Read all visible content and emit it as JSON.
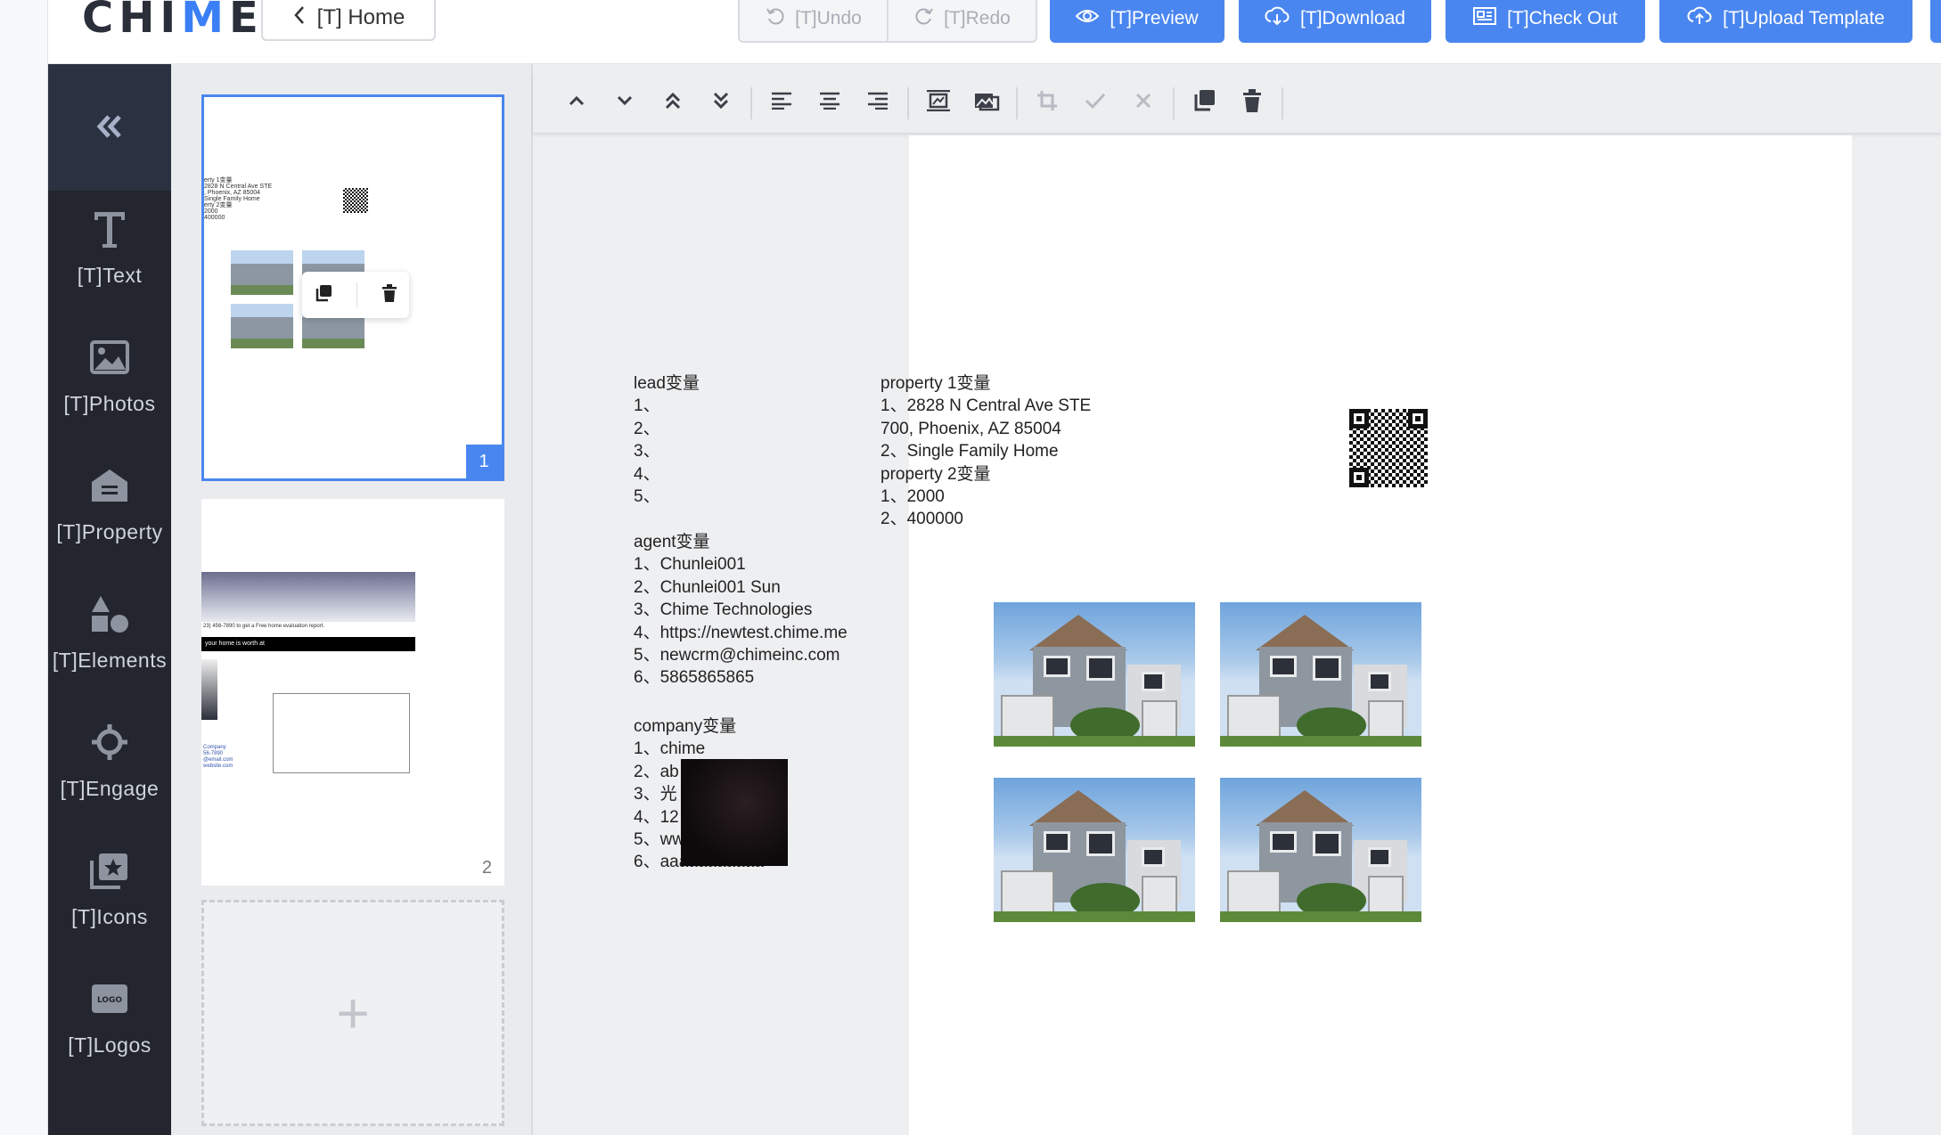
{
  "app": {
    "logo": "CHIME"
  },
  "topbar": {
    "home_label": "[T] Home",
    "undo_label": "[T]Undo",
    "redo_label": "[T]Redo",
    "preview_label": "[T]Preview",
    "download_label": "[T]Download",
    "checkout_label": "[T]Check Out",
    "upload_label": "[T]Upload Template",
    "accent_color": "#4a86f0"
  },
  "sidebar": {
    "collapse_icon": "double-chevron-left-icon",
    "items": [
      {
        "label": "[T]Text",
        "icon": "text-icon"
      },
      {
        "label": "[T]Photos",
        "icon": "image-icon"
      },
      {
        "label": "[T]Property",
        "icon": "house-icon"
      },
      {
        "label": "[T]Elements",
        "icon": "shapes-icon"
      },
      {
        "label": "[T]Engage",
        "icon": "crosshair-icon"
      },
      {
        "label": "[T]Icons",
        "icon": "star-gallery-icon"
      },
      {
        "label": "[T]Logos",
        "icon": "logo-icon"
      }
    ]
  },
  "pages": {
    "page1_number": "1",
    "page2_number": "2",
    "page1_text": "erty 1变量\n2828 N Central Ave STE\n, Phoenix, AZ 85004\nSingle Family Home\nerty 2变量\n2000\n400000",
    "page2_banner_text": "your home is worth at",
    "page2_phone_text": "23) 456-7890 to get a Free home evaluation report.",
    "page2_footer_text": "Company\n56-7890\n@email.com\nwebsite.com",
    "add_page_symbol": "+"
  },
  "canvas": {
    "lead_block": "lead变量\n1、\n2、\n3、\n4、\n5、",
    "agent_block": "agent变量\n1、Chunlei001\n2、Chunlei001 Sun\n3、Chime Technologies\n4、https://newtest.chime.me\n5、newcrm@chimeinc.com\n6、5865865865",
    "company_block": "company变量\n1、chime\n2、ab\n3、光\n4、12\n5、ww\n6、aaaaaaaaaaa",
    "property_block": "property 1变量\n1、2828 N Central Ave STE\n700, Phoenix, AZ 85004\n2、Single Family Home\nproperty 2变量\n1、2000\n2、400000"
  }
}
